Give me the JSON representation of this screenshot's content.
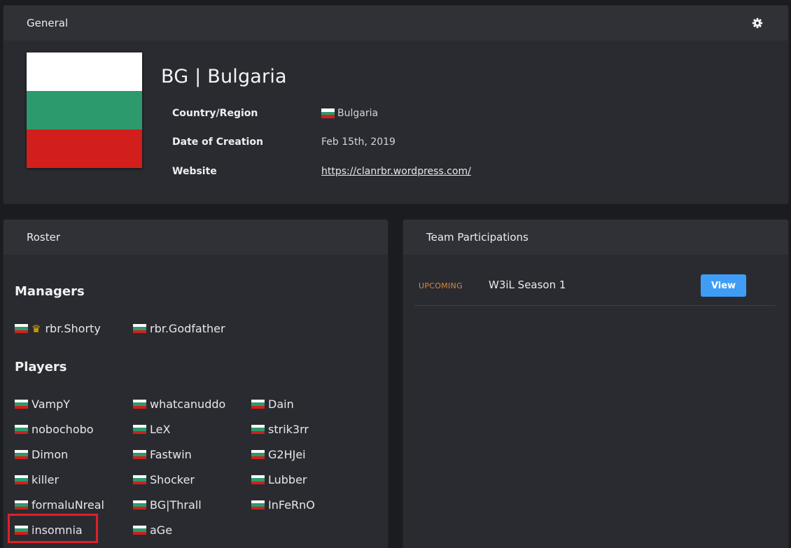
{
  "general": {
    "header": "General",
    "settings_icon": "gear-icon",
    "team_title": "BG | Bulgaria",
    "flag_colors": [
      "#ffffff",
      "#2d9a6d",
      "#d21f1b"
    ],
    "country_label": "Country/Region",
    "country_value": "Bulgaria",
    "creation_label": "Date of Creation",
    "creation_value": "Feb 15th, 2019",
    "website_label": "Website",
    "website_value": "https://clanrbr.wordpress.com/"
  },
  "roster": {
    "header": "Roster",
    "managers_title": "Managers",
    "managers": [
      {
        "name": "rbr.Shorty",
        "icon": "crown-icon"
      },
      {
        "name": "rbr.Godfather"
      }
    ],
    "players_title": "Players",
    "players": [
      "VampY",
      "whatcanuddo",
      "Dain",
      "nobochobo",
      "LeX",
      "strik3rr",
      "Dimon",
      "Fastwin",
      "G2HJei",
      "killer",
      "Shocker",
      "Lubber",
      "formaluNreal",
      "BG|Thrall",
      "InFeRnO",
      "insomnia",
      "aGe"
    ],
    "highlight_color": "#e0202a"
  },
  "participations": {
    "header": "Team Participations",
    "items": [
      {
        "status": "UPCOMING",
        "name": "W3iL Season 1",
        "action": "View"
      }
    ],
    "status_color": "#d68a3a",
    "button_color": "#3f9df5"
  }
}
